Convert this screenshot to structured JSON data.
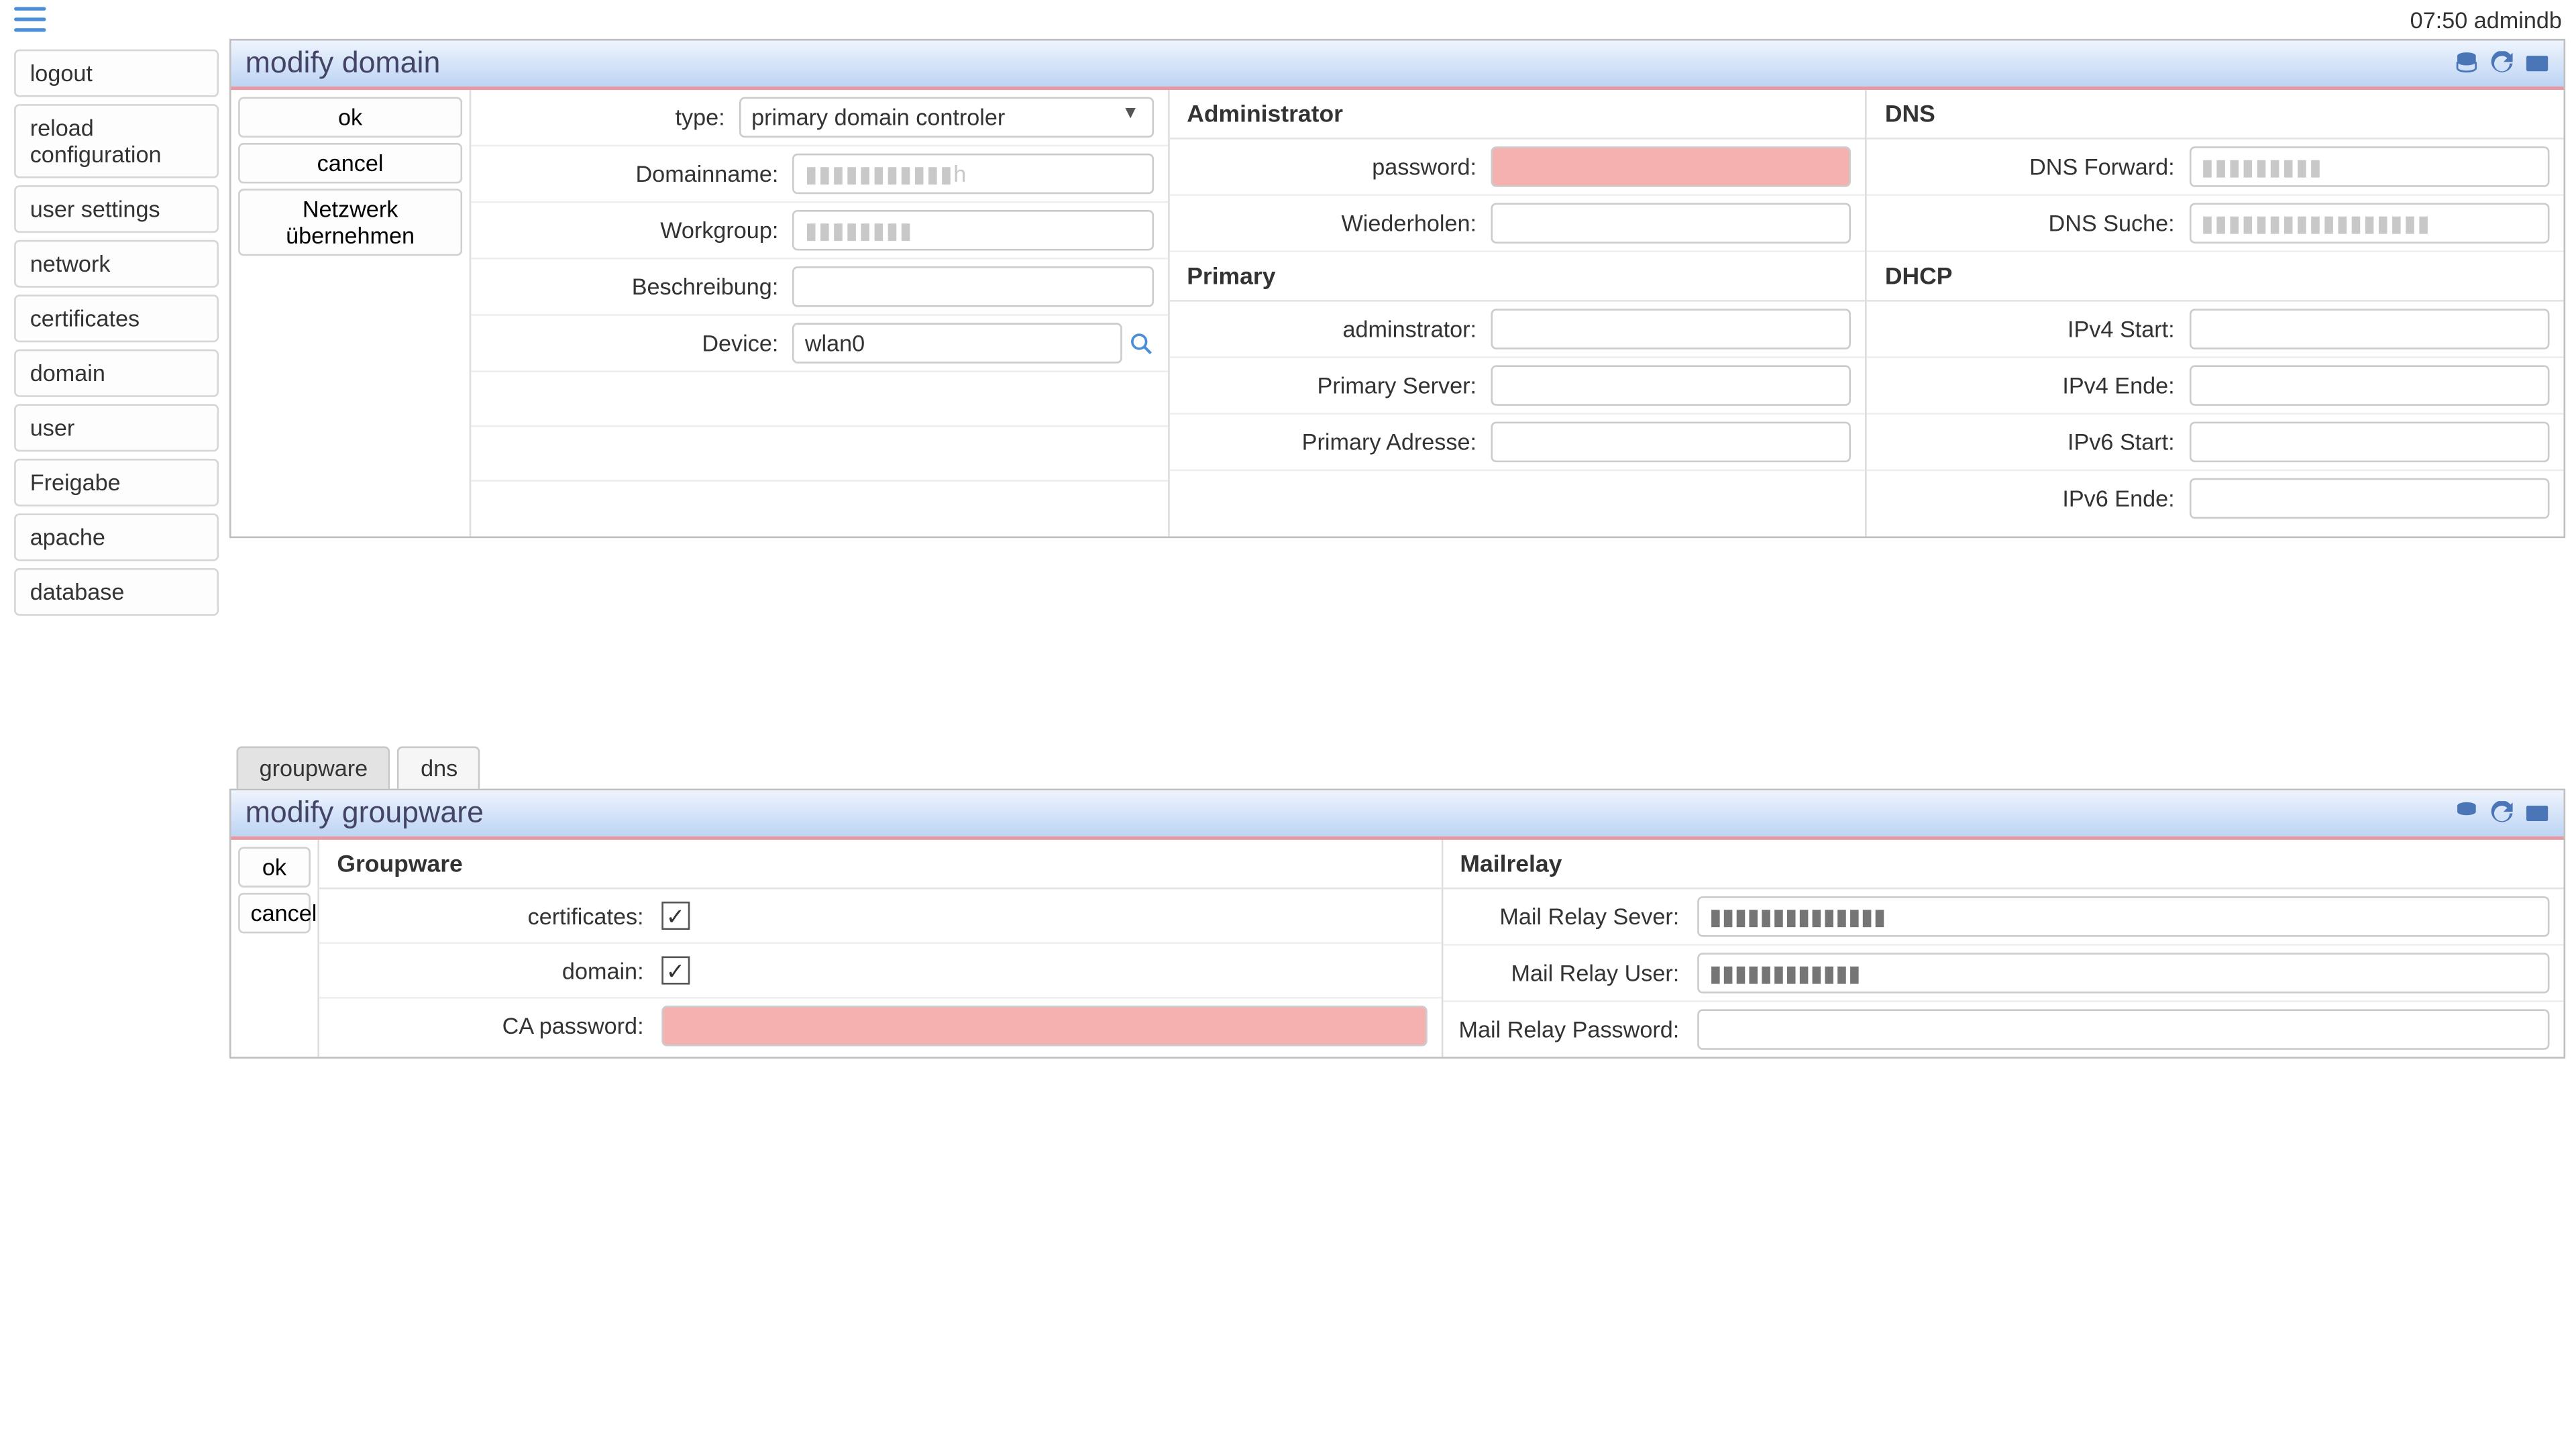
{
  "topbar": {
    "time_user": "07:50 admindb"
  },
  "sidebar": {
    "items": [
      "logout",
      "reload configuration",
      "user settings",
      "network",
      "certificates",
      "domain",
      "user",
      "Freigabe",
      "apache",
      "database"
    ]
  },
  "domainPanel": {
    "title": "modify domain",
    "actions": {
      "ok": "ok",
      "cancel": "cancel",
      "netz": "Netzwerk übernehmen"
    },
    "left": {
      "type_label": "type:",
      "type_value": "primary domain controler",
      "domainname_label": "Domainname:",
      "domainname_ph": "▮▮▮▮▮▮▮▮▮▮▮h",
      "workgroup_label": "Workgroup:",
      "workgroup_ph": "▮▮▮▮▮▮▮▮",
      "descr_label": "Beschreibung:",
      "device_label": "Device:",
      "device_value": "wlan0"
    },
    "mid": {
      "section": "Administrator",
      "password_label": "password:",
      "repeat_label": "Wiederholen:",
      "primary_section": "Primary",
      "admin2_label": "adminstrator:",
      "primary_server_label": "Primary Server:",
      "primary_addr_label": "Primary Adresse:"
    },
    "right": {
      "dns_section": "DNS",
      "dns_forward_label": "DNS Forward:",
      "dns_forward_ph": "▮▮▮▮▮▮▮▮▮",
      "dns_search_label": "DNS Suche:",
      "dns_search_ph": "▮▮▮▮▮▮▮▮▮▮▮▮▮▮▮▮▮",
      "dhcp_section": "DHCP",
      "v4start_label": "IPv4 Start:",
      "v4end_label": "IPv4 Ende:",
      "v6start_label": "IPv6 Start:",
      "v6end_label": "IPv6 Ende:"
    }
  },
  "tabs": {
    "groupware": "groupware",
    "dns": "dns"
  },
  "gwPanel": {
    "title": "modify groupware",
    "actions": {
      "ok": "ok",
      "cancel": "cancel"
    },
    "left": {
      "section": "Groupware",
      "cert_label": "certificates:",
      "cert_checked": true,
      "domain_label": "domain:",
      "domain_checked": true,
      "ca_label": "CA password:"
    },
    "right": {
      "section": "Mailrelay",
      "server_label": "Mail Relay Sever:",
      "server_ph": "▮▮▮▮▮▮▮▮▮▮▮▮▮▮",
      "user_label": "Mail Relay User:",
      "user_ph": "▮▮▮▮▮▮▮▮▮▮▮▮",
      "pass_label": "Mail Relay Password:"
    }
  }
}
